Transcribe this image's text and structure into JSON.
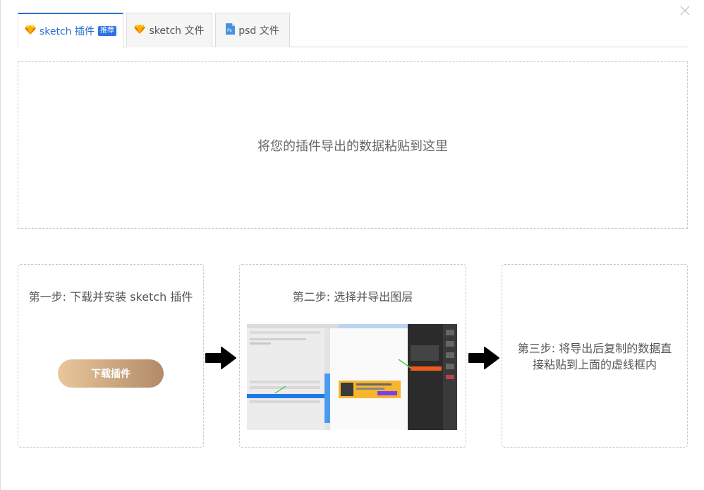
{
  "tabs": [
    {
      "label": "sketch 插件",
      "badge": "推荐",
      "icon": "sketch-icon",
      "active": true
    },
    {
      "label": "sketch 文件",
      "icon": "sketch-icon",
      "active": false
    },
    {
      "label": "psd 文件",
      "icon": "psd-file-icon",
      "active": false
    }
  ],
  "paste_area": {
    "placeholder": "将您的插件导出的数据粘贴到这里"
  },
  "steps": [
    {
      "title": "第一步: 下载并安装 sketch 插件",
      "button_label": "下载插件"
    },
    {
      "title": "第二步: 选择并导出图层"
    },
    {
      "text_line1": "第三步: 将导出后复制的数据直",
      "text_line2": "接粘贴到上面的虚线框内"
    }
  ],
  "icons": {
    "close": "close-icon",
    "arrow": "arrow-right-icon"
  },
  "colors": {
    "accent": "#2b6fcf",
    "badge": "#2b72e6",
    "button_start": "#e9c79b",
    "button_end": "#b28a6a"
  }
}
